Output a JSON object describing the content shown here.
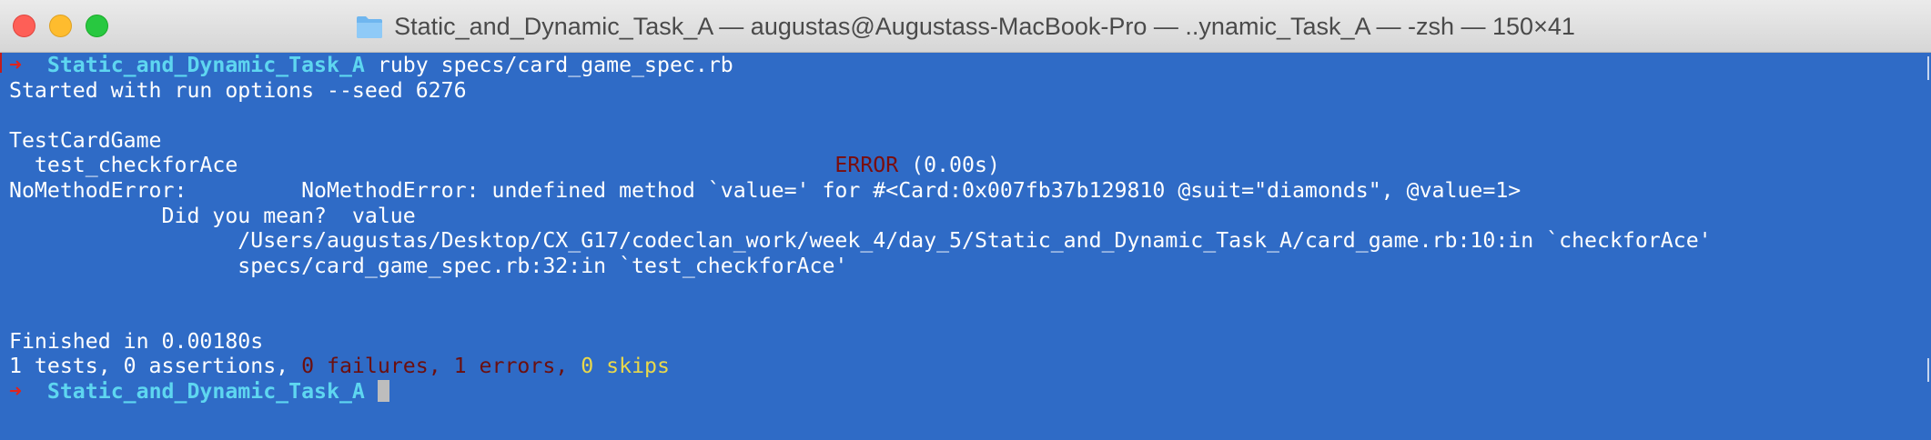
{
  "window": {
    "title": "Static_and_Dynamic_Task_A — augustas@Augustass-MacBook-Pro — ..ynamic_Task_A — -zsh — 150×41",
    "controls": {
      "close": "close-button",
      "minimize": "minimize-button",
      "maximize": "maximize-button"
    }
  },
  "terminal": {
    "prompt_arrow": "➜",
    "cwd": "Static_and_Dynamic_Task_A",
    "command": " ruby specs/card_game_spec.rb",
    "lines": {
      "run_options": "Started with run options --seed 6276",
      "suite": "TestCardGame",
      "test_name": "  test_checkforAce                                               ",
      "error_label": "ERROR",
      "error_time": " (0.00s)",
      "error_line": "NoMethodError:         NoMethodError: undefined method `value=' for #<Card:0x007fb37b129810 @suit=\"diamonds\", @value=1>",
      "did_you_mean": "            Did you mean?  value",
      "trace_1": "                  /Users/augustas/Desktop/CX_G17/codeclan_work/week_4/day_5/Static_and_Dynamic_Task_A/card_game.rb:10:in `checkforAce'",
      "trace_2": "                  specs/card_game_spec.rb:32:in `test_checkforAce'",
      "finished": "Finished in 0.00180s"
    },
    "summary": {
      "prefix": "1 tests, 0 assertions, ",
      "failures": "0 failures,",
      "sep1": " ",
      "errors": "1 errors,",
      "sep2": " ",
      "skips": "0 skips"
    },
    "colors": {
      "background": "#2f6bc6",
      "foreground": "#ffffff",
      "prompt_arrow": "#e0231c",
      "cwd": "#5ed6f0",
      "error": "#7a0d0d",
      "skips": "#e9d84b"
    }
  }
}
